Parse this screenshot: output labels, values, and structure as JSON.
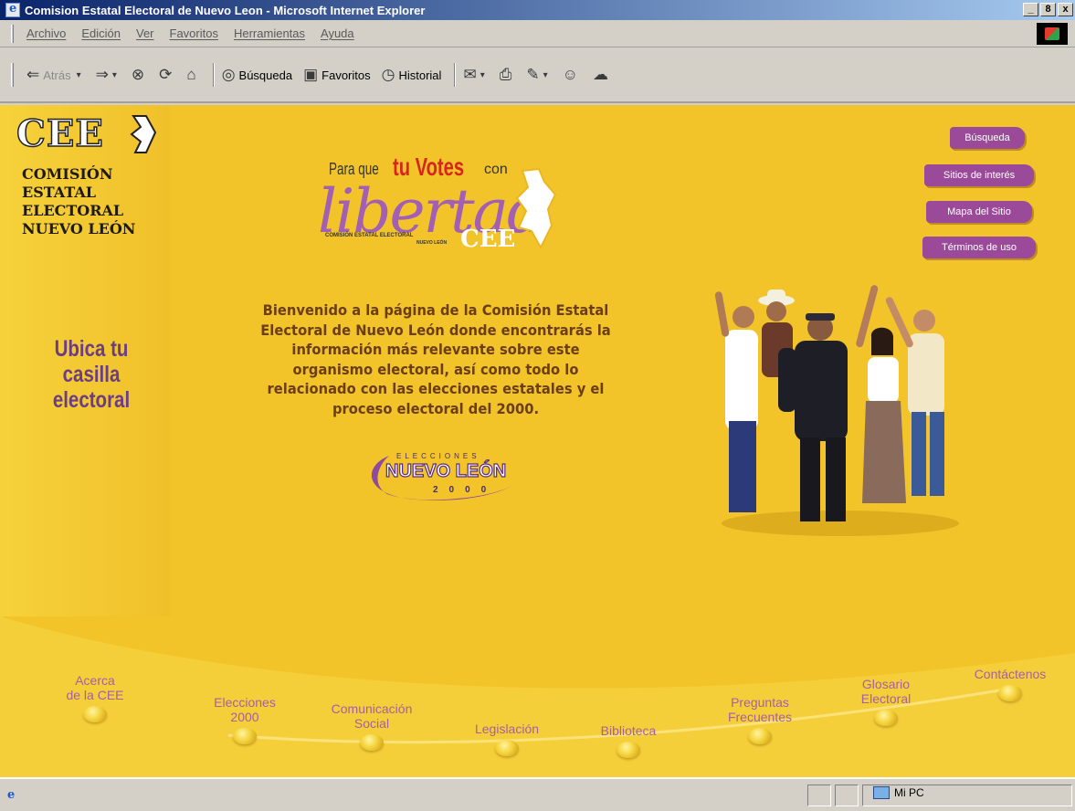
{
  "window": {
    "title": "Comision Estatal Electoral de Nuevo Leon - Microsoft Internet Explorer",
    "controls": [
      "_",
      "8",
      "x"
    ]
  },
  "menu": [
    "Archivo",
    "Edición",
    "Ver",
    "Favoritos",
    "Herramientas",
    "Ayuda"
  ],
  "toolbar": {
    "back": "Atrás",
    "search": "Búsqueda",
    "favorites": "Favoritos",
    "history": "Historial"
  },
  "page": {
    "logo": {
      "cee": "CEE",
      "lines": [
        "COMISIÓN",
        "ESTATAL",
        "ELECTORAL",
        "NUEVO LEÓN"
      ]
    },
    "ubica": [
      "Ubica tu",
      "casilla",
      "electoral"
    ],
    "slogan": {
      "para_que": "Para que",
      "tu_votes": "tu Votes",
      "con": "con",
      "libertad": "libertad",
      "small_1": "COMISIÓN ESTATAL ELECTORAL",
      "small_2": "NUEVO LEÓN",
      "cee": "CEE"
    },
    "welcome": [
      "Bienvenido a la página de la Comisión Estatal",
      "Electoral de Nuevo León donde encontrarás la",
      "información más relevante sobre este",
      "organismo electoral, así como todo lo",
      "relacionado con las elecciones estatales y el",
      "proceso electoral del 2000."
    ],
    "elecciones_logo": {
      "top": "ELECCIONES",
      "main": "NUEVO LEÓN",
      "year": "2000"
    },
    "right_nav": [
      "Búsqueda",
      "Sitios de interés",
      "Mapa del Sitio",
      "Términos de uso"
    ],
    "bottom_nav": [
      [
        "Acerca",
        "de la CEE"
      ],
      [
        "Elecciones",
        "2000"
      ],
      [
        "Comunicación",
        "Social"
      ],
      [
        "Legislación"
      ],
      [
        "Biblioteca"
      ],
      [
        "Preguntas",
        "Frecuentes"
      ],
      [
        "Glosario",
        "Electoral"
      ],
      [
        "Contáctenos"
      ]
    ]
  },
  "status": {
    "zone": "Mi PC"
  },
  "colors": {
    "page_bg": "#f2c42a",
    "accent_purple": "#9a4a98",
    "title_blue": "#0a246a"
  }
}
